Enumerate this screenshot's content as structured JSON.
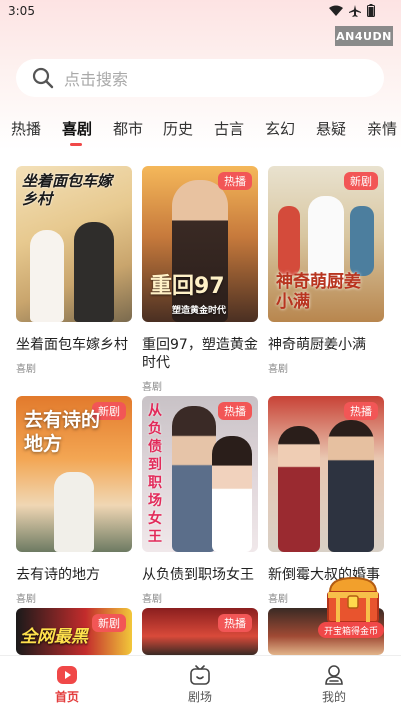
{
  "status_bar": {
    "time": "3:05"
  },
  "watermark": "AN4UDN",
  "search": {
    "placeholder": "点击搜索"
  },
  "tabs": [
    "热播",
    "喜剧",
    "都市",
    "历史",
    "古言",
    "玄幻",
    "悬疑",
    "亲情"
  ],
  "active_tab": "喜剧",
  "cards": [
    {
      "title": "坐着面包车嫁乡村",
      "genre": "喜剧",
      "badge": "",
      "poster_text": "坐着面包车嫁乡村"
    },
    {
      "title": "重回97，塑造黄金时代",
      "genre": "喜剧",
      "badge": "热播",
      "poster_text": "重回97",
      "poster_subtext": "塑造黄金时代"
    },
    {
      "title": "神奇萌厨姜小满",
      "genre": "喜剧",
      "badge": "新剧",
      "poster_text": "神奇萌厨姜小满"
    },
    {
      "title": "去有诗的地方",
      "genre": "喜剧",
      "badge": "新剧",
      "poster_text": "去有诗的地方"
    },
    {
      "title": "从负债到职场女王",
      "genre": "喜剧",
      "badge": "热播",
      "poster_text": "从负债到职场女王"
    },
    {
      "title": "新倒霉大叔的婚事",
      "genre": "喜剧",
      "badge": "热播",
      "poster_text": ""
    },
    {
      "title": "",
      "genre": "",
      "badge": "新剧",
      "poster_text": "全网最黑"
    },
    {
      "title": "",
      "genre": "",
      "badge": "热播",
      "poster_text": ""
    },
    {
      "title": "",
      "genre": "",
      "badge": "",
      "poster_text": ""
    }
  ],
  "float_widget": {
    "label": "开宝箱得金币"
  },
  "bottom_nav": [
    {
      "label": "首页",
      "icon": "home-play-icon",
      "active": true
    },
    {
      "label": "剧场",
      "icon": "tv-icon",
      "active": false
    },
    {
      "label": "我的",
      "icon": "user-icon",
      "active": false
    }
  ],
  "colors": {
    "accent": "#f04848",
    "badge": "#f25656",
    "top_gradient": "#fde3e3"
  }
}
